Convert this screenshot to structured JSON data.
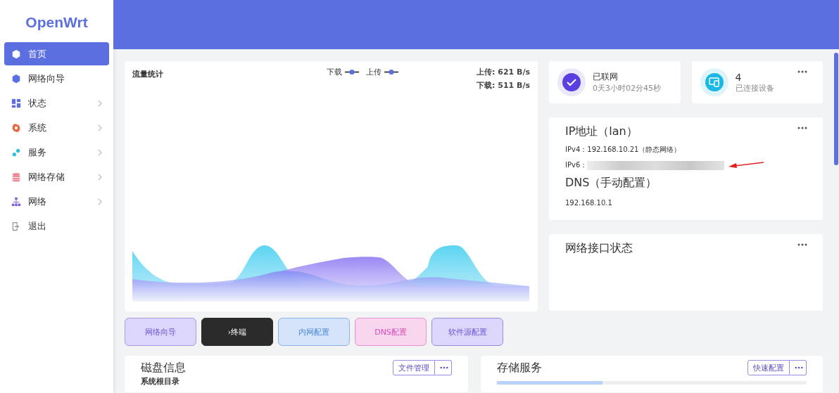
{
  "sidebar": {
    "logo": "OpenWrt",
    "items": [
      {
        "label": "首页",
        "selected": true,
        "has_submenu": false
      },
      {
        "label": "网络向导",
        "selected": false,
        "has_submenu": false
      },
      {
        "label": "状态",
        "selected": false,
        "has_submenu": true
      },
      {
        "label": "系统",
        "selected": false,
        "has_submenu": true
      },
      {
        "label": "服务",
        "selected": false,
        "has_submenu": true
      },
      {
        "label": "网络存储",
        "selected": false,
        "has_submenu": true
      },
      {
        "label": "网络",
        "selected": false,
        "has_submenu": true
      },
      {
        "label": "退出",
        "selected": false,
        "has_submenu": false
      }
    ]
  },
  "traffic": {
    "title": "流量统计",
    "legend": [
      {
        "label": "下载",
        "on": true
      },
      {
        "label": "上传",
        "on": true
      }
    ],
    "upload": "上传: 621 B/s",
    "download": "下载: 511 B/s"
  },
  "status_cards": [
    {
      "kind": "internet",
      "title": "已联网",
      "subtitle": "0天3小时02分45秒",
      "menu": false
    },
    {
      "kind": "devices",
      "title": "4",
      "subtitle": "已连接设备",
      "menu": true
    }
  ],
  "ip_card": {
    "title": "IP地址（lan）",
    "ipv4_label": "IPv4：",
    "ipv4": "192.168.10.21（静态网络）",
    "ipv6_label": "IPv6：",
    "dns_title": "DNS（手动配置）",
    "dns": "192.168.10.1"
  },
  "interface_card": {
    "title": "网络接口状态"
  },
  "quick_buttons": [
    {
      "label": "网络向导",
      "kind": "wizard"
    },
    {
      "label": "›终端",
      "kind": "terminal"
    },
    {
      "label": "内网配置",
      "kind": "lan"
    },
    {
      "label": "DNS配置",
      "kind": "dns"
    },
    {
      "label": "软件源配置",
      "kind": "source"
    }
  ],
  "disk_card": {
    "title": "磁盘信息",
    "button": "文件管理",
    "section": "系统根目录"
  },
  "storage_card": {
    "title": "存储服务",
    "button": "快速配置",
    "level": 0.34
  }
}
